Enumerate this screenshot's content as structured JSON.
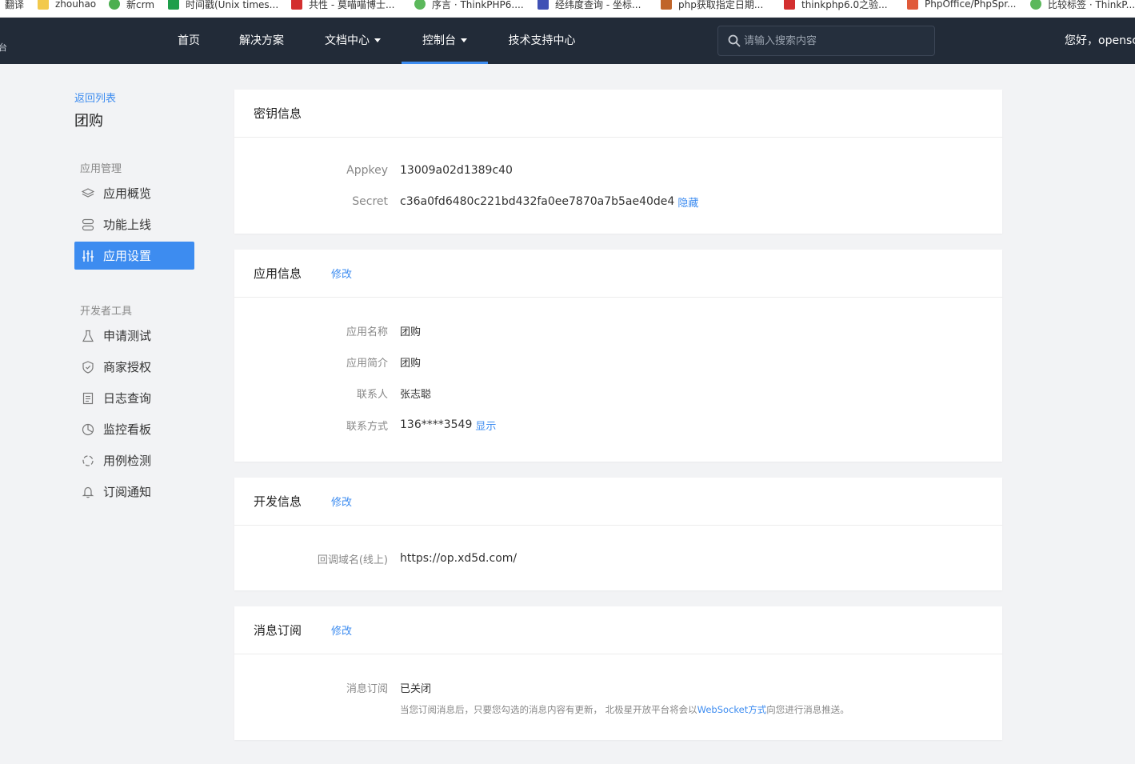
{
  "bookmarks": [
    {
      "label": "翻译",
      "icon": "translate-icon",
      "color": "#4a7bd0"
    },
    {
      "label": "zhouhao",
      "icon": "folder-icon",
      "color": "#f2c94c"
    },
    {
      "label": "新crm",
      "icon": "wechat-icon",
      "color": "#4caf50"
    },
    {
      "label": "时间戳(Unix times...",
      "icon": "sheet-icon",
      "color": "#1e9e4a"
    },
    {
      "label": "共性 - 莫喵喵博士...",
      "icon": "c-logo-icon",
      "color": "#d32f2f"
    },
    {
      "label": "序言 · ThinkPHP6....",
      "icon": "leaf-icon",
      "color": "#5cb85c"
    },
    {
      "label": "经纬度查询 - 坐标...",
      "icon": "globe-icon",
      "color": "#3f51b5"
    },
    {
      "label": "php获取指定日期...",
      "icon": "b-logo-icon",
      "color": "#c0652a"
    },
    {
      "label": "thinkphp6.0之验...",
      "icon": "c-logo-icon",
      "color": "#d32f2f"
    },
    {
      "label": "PhpOffice/PhpSpr...",
      "icon": "square-logo-icon",
      "color": "#e05a3a"
    },
    {
      "label": "比较标签 · ThinkP...",
      "icon": "leaf-icon",
      "color": "#5cb85c"
    }
  ],
  "header": {
    "brand_line1": "台",
    "nav": [
      {
        "label": "首页",
        "dropdown": false,
        "active": false
      },
      {
        "label": "解决方案",
        "dropdown": false,
        "active": false
      },
      {
        "label": "文档中心",
        "dropdown": true,
        "active": false
      },
      {
        "label": "控制台",
        "dropdown": true,
        "active": true
      },
      {
        "label": "技术支持中心",
        "dropdown": false,
        "active": false
      }
    ],
    "search_placeholder": "请输入搜索内容",
    "greeting": "您好，opensc"
  },
  "sidebar": {
    "back_label": "返回列表",
    "app_name": "团购",
    "groups": [
      {
        "title": "应用管理",
        "items": [
          {
            "label": "应用概览",
            "icon": "layers-icon",
            "active": false
          },
          {
            "label": "功能上线",
            "icon": "server-icon",
            "active": false
          },
          {
            "label": "应用设置",
            "icon": "sliders-icon",
            "active": true
          }
        ]
      },
      {
        "title": "开发者工具",
        "items": [
          {
            "label": "申请测试",
            "icon": "flask-icon",
            "active": false
          },
          {
            "label": "商家授权",
            "icon": "shield-check-icon",
            "active": false
          },
          {
            "label": "日志查询",
            "icon": "document-icon",
            "active": false
          },
          {
            "label": "监控看板",
            "icon": "pie-chart-icon",
            "active": false
          },
          {
            "label": "用例检测",
            "icon": "refresh-circle-icon",
            "active": false
          },
          {
            "label": "订阅通知",
            "icon": "bell-icon",
            "active": false
          }
        ]
      }
    ]
  },
  "cards": {
    "key_info": {
      "title": "密钥信息",
      "appkey_label": "Appkey",
      "appkey_value": "13009a02d1389c40",
      "secret_label": "Secret",
      "secret_value": "c36a0fd6480c221bd432fa0ee7870a7b5ae40de4",
      "secret_toggle": "隐藏"
    },
    "app_info": {
      "title": "应用信息",
      "edit_label": "修改",
      "rows": [
        {
          "label": "应用名称",
          "value": "团购"
        },
        {
          "label": "应用简介",
          "value": "团购"
        },
        {
          "label": "联系人",
          "value": "张志聪"
        }
      ],
      "contact_label": "联系方式",
      "contact_value": "136****3549",
      "contact_toggle": "显示"
    },
    "dev_info": {
      "title": "开发信息",
      "edit_label": "修改",
      "callback_label": "回调域名(线上)",
      "callback_value": "https://op.xd5d.com/"
    },
    "subscription": {
      "title": "消息订阅",
      "edit_label": "修改",
      "status_label": "消息订阅",
      "status_value": "已关闭",
      "note_before": "当您订阅消息后，只要您勾选的消息内容有更新， 北极星开放平台将会以",
      "note_link": "WebSocket方式",
      "note_after": "向您进行消息推送。"
    }
  },
  "colors": {
    "accent": "#3d8cf0",
    "nav_bg": "#222b38",
    "page_bg": "#f2f3f5"
  }
}
